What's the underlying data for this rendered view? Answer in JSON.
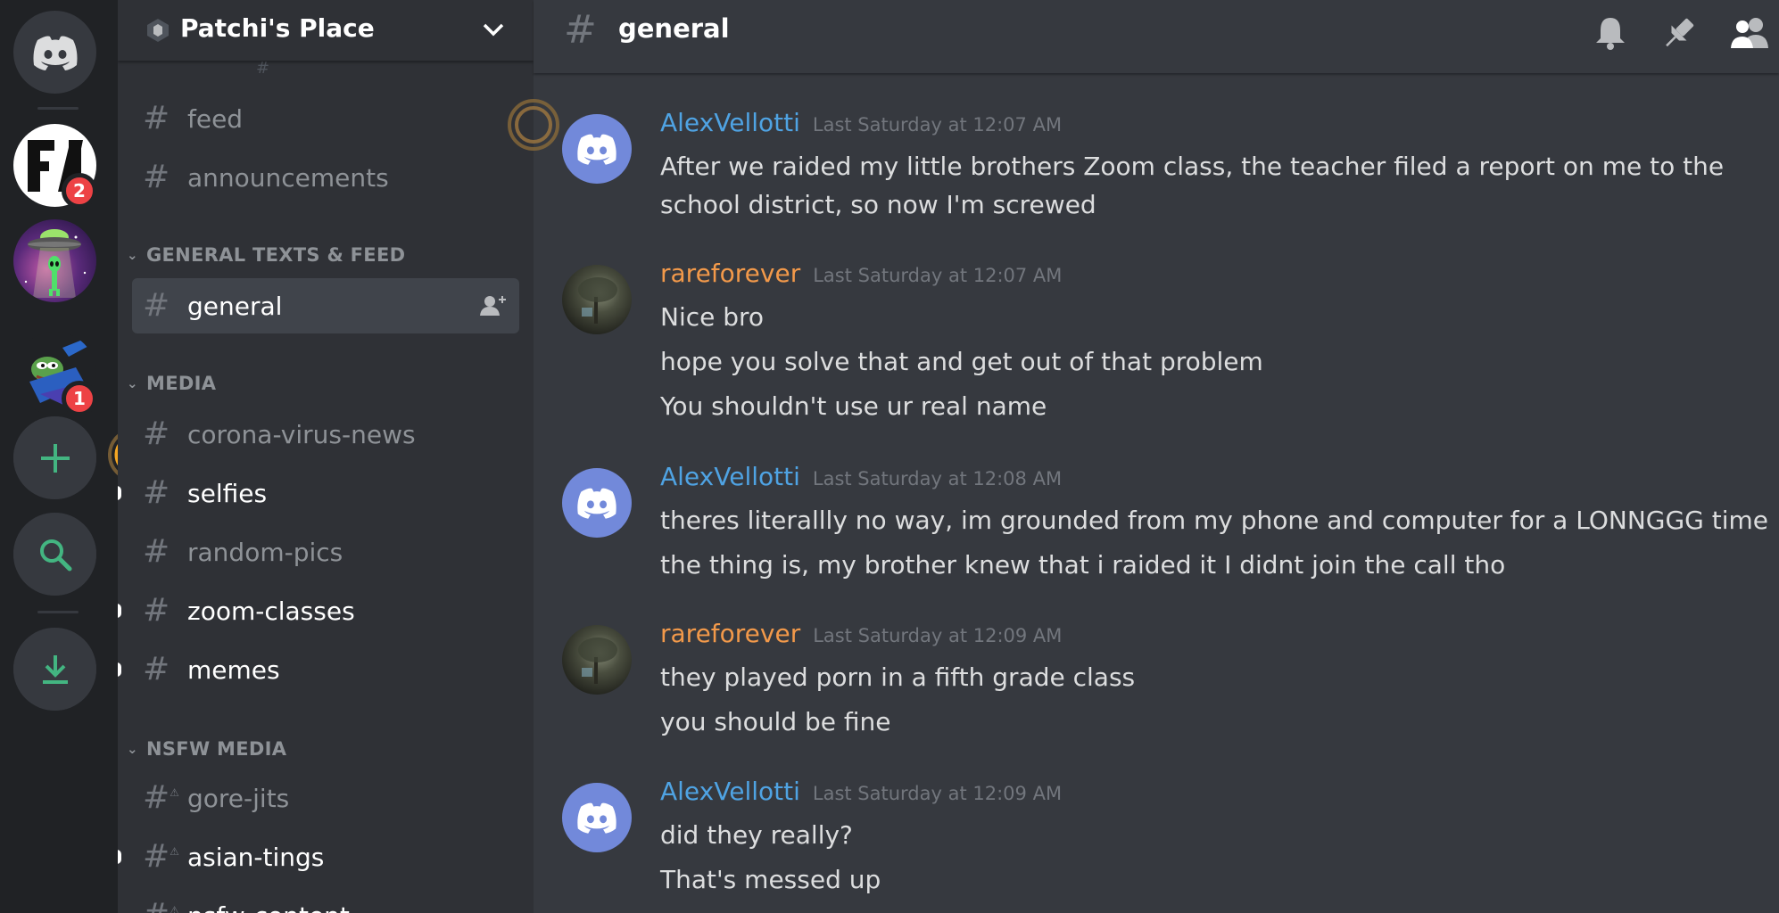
{
  "server": {
    "name": "Patchi's Place",
    "badges": [
      "2",
      "1"
    ]
  },
  "channel": {
    "title": "general"
  },
  "sidebar": {
    "channels_top": [
      {
        "label": "feed"
      },
      {
        "label": "announcements"
      }
    ],
    "categories": [
      {
        "label": "GENERAL TEXTS & FEED",
        "channels": [
          {
            "label": "general"
          }
        ]
      },
      {
        "label": "MEDIA",
        "channels": [
          {
            "label": "corona-virus-news"
          },
          {
            "label": "selfies"
          },
          {
            "label": "random-pics"
          },
          {
            "label": "zoom-classes"
          },
          {
            "label": "memes"
          }
        ]
      },
      {
        "label": "NSFW MEDIA",
        "channels": [
          {
            "label": "gore-jits"
          },
          {
            "label": "asian-tings"
          },
          {
            "label": "nsfw-content"
          }
        ]
      }
    ]
  },
  "messages": [
    {
      "author": "AlexVellotti",
      "time": "Last Saturday at 12:07 AM",
      "lines": [
        "After we raided my little brothers Zoom class, the teacher filed a report on me to the",
        "school district, so now I'm screwed"
      ]
    },
    {
      "author": "rareforever",
      "time": "Last Saturday at 12:07 AM",
      "lines": [
        "Nice bro",
        "hope you solve that and get out of that problem",
        "You shouldn't use ur real name"
      ]
    },
    {
      "author": "AlexVellotti",
      "time": "Last Saturday at 12:08 AM",
      "lines": [
        "theres literallly no way, im grounded from my phone and computer for a LONNGGG time",
        "the thing is, my brother knew that i raided it I didnt join the call tho"
      ]
    },
    {
      "author": "rareforever",
      "time": "Last Saturday at 12:09 AM",
      "lines": [
        "they played porn in a fifth grade class",
        "you should be fine"
      ]
    },
    {
      "author": "AlexVellotti",
      "time": "Last Saturday at 12:09 AM",
      "lines": [
        "did they really?",
        "That's messed up"
      ]
    }
  ],
  "colors": {
    "author_blue": "#4fa3e3",
    "author_orange": "#f2994a",
    "blurple": "#7289da",
    "green": "#43b581",
    "badge_red": "#ed4245"
  },
  "icons": [
    "discord-home-icon",
    "fa-server-icon",
    "ufo-server-icon",
    "pepe-server-icon",
    "add-server-icon",
    "explore-icon",
    "download-icon",
    "bell-icon",
    "pin-icon",
    "members-icon",
    "add-member-icon"
  ]
}
